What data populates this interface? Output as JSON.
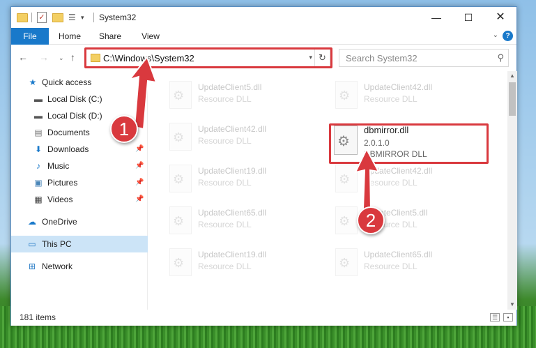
{
  "window": {
    "title": "System32",
    "controls": {
      "minimize": "—",
      "maximize": "☐",
      "close": "✕"
    }
  },
  "ribbon": {
    "tabs": [
      {
        "label": "File"
      },
      {
        "label": "Home"
      },
      {
        "label": "Share"
      },
      {
        "label": "View"
      }
    ],
    "help_label": "?"
  },
  "nav": {
    "back": "←",
    "forward": "→",
    "recent": "⌄",
    "up": "↑",
    "address": "C:\\Windows\\System32",
    "refresh": "↻",
    "search_placeholder": "Search System32"
  },
  "sidebar": {
    "items": [
      {
        "label": "Quick access",
        "icon": "star-icon"
      },
      {
        "label": "Local Disk (C:)",
        "icon": "drive-icon"
      },
      {
        "label": "Local Disk (D:)",
        "icon": "drive-icon"
      },
      {
        "label": "Documents",
        "icon": "documents-icon"
      },
      {
        "label": "Downloads",
        "icon": "download-icon"
      },
      {
        "label": "Music",
        "icon": "music-icon"
      },
      {
        "label": "Pictures",
        "icon": "pictures-icon"
      },
      {
        "label": "Videos",
        "icon": "videos-icon"
      },
      {
        "label": "OneDrive",
        "icon": "cloud-icon"
      },
      {
        "label": "This PC",
        "icon": "computer-icon",
        "selected": true
      },
      {
        "label": "Network",
        "icon": "network-icon"
      }
    ]
  },
  "files": {
    "left": [
      {
        "name": "UpdateClient5.dll",
        "type": "Resource DLL"
      },
      {
        "name": "UpdateClient42.dll",
        "type": "Resource DLL"
      },
      {
        "name": "UpdateClient19.dll",
        "type": "Resource DLL"
      },
      {
        "name": "UpdateClient65.dll",
        "type": "Resource DLL"
      },
      {
        "name": "UpdateClient19.dll",
        "type": "Resource DLL"
      }
    ],
    "right": [
      {
        "name": "UpdateClient42.dll",
        "type": "Resource DLL"
      },
      {
        "name": "UpdateClient42.dll",
        "type": "Resource DLL"
      },
      {
        "name": "UpdateClient5.dll",
        "type": "Resource DLL"
      },
      {
        "name": "UpdateClient65.dll",
        "type": "Resource DLL"
      }
    ],
    "highlighted": {
      "name": "dbmirror.dll",
      "version": "2.0.1.0",
      "type": "DBMIRROR DLL"
    }
  },
  "status": {
    "item_count": "181 items"
  },
  "annotations": {
    "step1": "1",
    "step2": "2",
    "color": "#d9393e"
  }
}
